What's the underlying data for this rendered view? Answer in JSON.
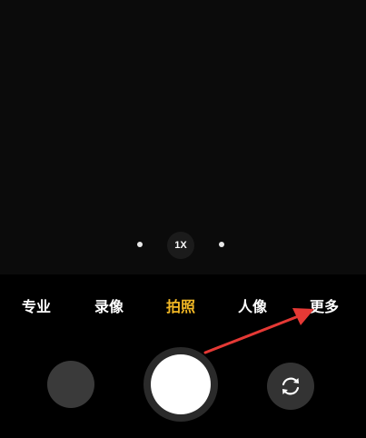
{
  "viewfinder": {
    "zoom_label": "1X"
  },
  "modes": {
    "items": [
      {
        "label": "专业",
        "active": false
      },
      {
        "label": "录像",
        "active": false
      },
      {
        "label": "拍照",
        "active": true
      },
      {
        "label": "人像",
        "active": false
      },
      {
        "label": "更多",
        "active": false
      }
    ]
  },
  "controls": {
    "gallery_icon": "gallery-thumbnail",
    "shutter_icon": "shutter-circle",
    "switch_icon": "camera-switch-icon"
  },
  "colors": {
    "active_mode": "#f2b825",
    "annotation_arrow": "#e53935"
  }
}
